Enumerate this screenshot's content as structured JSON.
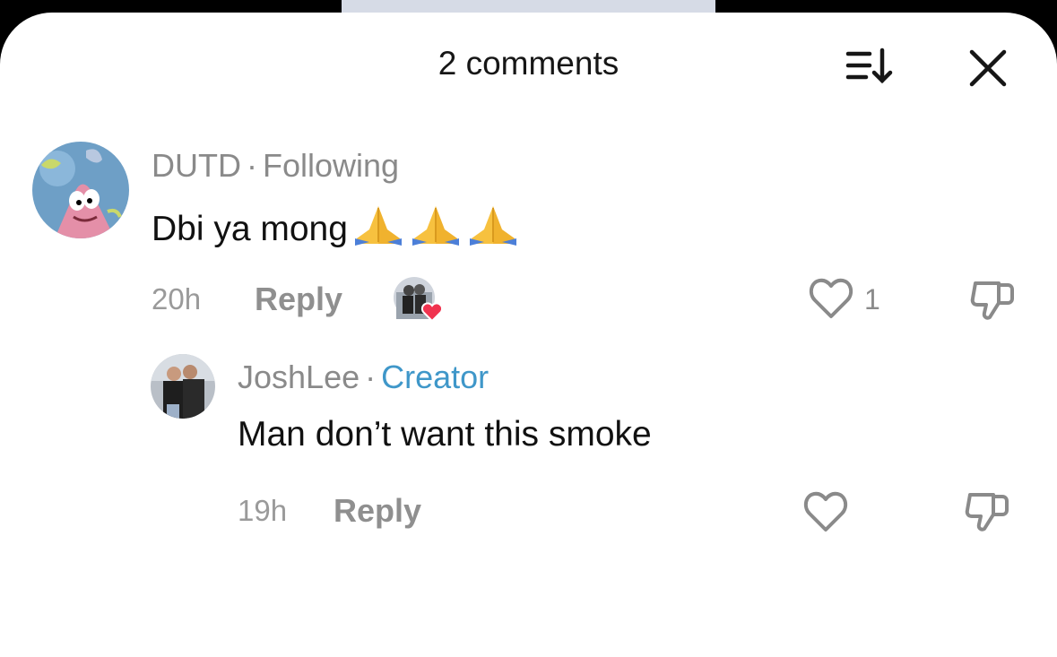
{
  "header": {
    "title": "2 comments",
    "sort_icon": "sort-descending-icon",
    "close_icon": "close-icon"
  },
  "comments": [
    {
      "author": "DUTD",
      "relation": "Following",
      "text": "Dbi ya mong",
      "emoji": [
        "folded-hands-emoji",
        "folded-hands-emoji",
        "folded-hands-emoji"
      ],
      "time": "20h",
      "reply_label": "Reply",
      "likes": "1",
      "liked_by_creator": true
    },
    {
      "author": "JoshLee",
      "badge": "Creator",
      "text": "Man don’t want this smoke",
      "time": "19h",
      "reply_label": "Reply"
    }
  ],
  "colors": {
    "creator_badge": "#3f97c9",
    "creator_heart": "#f0334f",
    "meta_text": "#8a8a8a"
  }
}
